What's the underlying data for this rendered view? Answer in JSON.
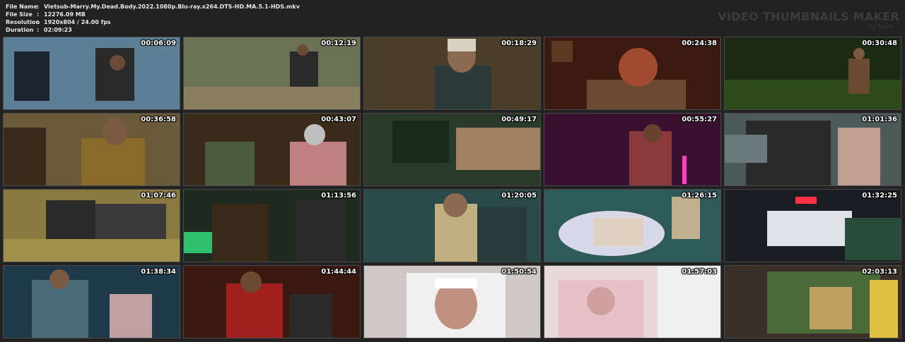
{
  "info": {
    "rows": [
      {
        "key": "File Name",
        "sep": ":",
        "value": "Vietsub-Marry.My.Dead.Body.2022.1080p.Blu-ray.x264.DTS-HD.MA.5.1-HDS.mkv"
      },
      {
        "key": "File Size",
        "sep": ":",
        "value": "12276.09 MB"
      },
      {
        "key": "Resolution",
        "sep": ":",
        "value": "1920x804 / 24.00 fps"
      },
      {
        "key": "Duration",
        "sep": ":",
        "value": "02:09:23"
      }
    ]
  },
  "brand": {
    "title": "VIDEO THUMBNAILS MAKER",
    "subtitle": "by Scorp"
  },
  "thumbnails": [
    {
      "timestamp": "00:06:09",
      "bg": "#5b7f95"
    },
    {
      "timestamp": "00:12:19",
      "bg": "#6b7253"
    },
    {
      "timestamp": "00:18:29",
      "bg": "#4a3e2a"
    },
    {
      "timestamp": "00:24:38",
      "bg": "#3b1a12"
    },
    {
      "timestamp": "00:30:48",
      "bg": "#1c2a14"
    },
    {
      "timestamp": "00:36:58",
      "bg": "#6a5a3a"
    },
    {
      "timestamp": "00:43:07",
      "bg": "#3a2a1a"
    },
    {
      "timestamp": "00:49:17",
      "bg": "#2d3a2a"
    },
    {
      "timestamp": "00:55:27",
      "bg": "#3a1030"
    },
    {
      "timestamp": "01:01:36",
      "bg": "#4d5a5a"
    },
    {
      "timestamp": "01:07:46",
      "bg": "#8a7a40"
    },
    {
      "timestamp": "01:13:56",
      "bg": "#1e2a1e"
    },
    {
      "timestamp": "01:20:05",
      "bg": "#2a4a4a"
    },
    {
      "timestamp": "01:26:15",
      "bg": "#2f5a5a"
    },
    {
      "timestamp": "01:32:25",
      "bg": "#1a1e22"
    },
    {
      "timestamp": "01:38:34",
      "bg": "#1e3a4a"
    },
    {
      "timestamp": "01:44:44",
      "bg": "#3a1a10"
    },
    {
      "timestamp": "01:50:54",
      "bg": "#cfc9c5"
    },
    {
      "timestamp": "01:57:03",
      "bg": "#e8d8d8"
    },
    {
      "timestamp": "02:03:13",
      "bg": "#3a3028"
    }
  ]
}
